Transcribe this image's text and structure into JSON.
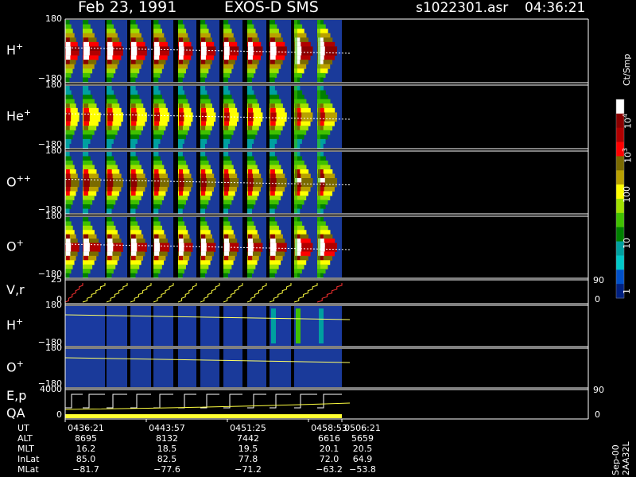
{
  "header": {
    "date": "Feb 23, 1991",
    "instrument": "EXOS-D SMS",
    "file": "s1022301.asr",
    "time": "04:36:21"
  },
  "side_note": "Sep-00 2AA32L",
  "colorbar": {
    "unit": "Ct/Smp",
    "ticks": [
      "10",
      "1",
      "100",
      "10",
      "1"
    ],
    "tick_exps": [
      "4",
      "",
      "",
      "",
      ""
    ],
    "tick_lbl_0": "10",
    "tick_lbl_0_exp": "4",
    "tick_lbl_1": "10",
    "tick_lbl_1_exp": "3",
    "tick_lbl_2": "100",
    "tick_lbl_3": "10",
    "tick_lbl_4": "1",
    "colors": [
      "#ffffff",
      "#8b0000",
      "#b00000",
      "#ff0000",
      "#7a6a00",
      "#b8a000",
      "#ffff00",
      "#a0e000",
      "#40c000",
      "#008000",
      "#00a0a0",
      "#00c8c8",
      "#0050c8",
      "#002080"
    ]
  },
  "panels": [
    {
      "label": "H",
      "sup": "+",
      "ymax": "180",
      "ymin": "−180"
    },
    {
      "label": "He",
      "sup": "+",
      "ymax": "180",
      "ymin": "−180"
    },
    {
      "label": "O",
      "sup": "++",
      "ymax": "180",
      "ymin": "−180"
    },
    {
      "label": "O",
      "sup": "+",
      "ymax": "180",
      "ymin": "−180"
    },
    {
      "label": "V,r",
      "sup": "",
      "ymax": "25",
      "ymin": "0",
      "rmax": "90",
      "rmin": "0"
    },
    {
      "label": "H",
      "sup": "+",
      "ymax": "180",
      "ymin": "−180"
    },
    {
      "label": "O",
      "sup": "+",
      "ymax": "180",
      "ymin": "−180"
    },
    {
      "label": "E,p",
      "sup": "",
      "ymax": "4000",
      "ymin": "0",
      "rmax": "90",
      "rmin": "0"
    }
  ],
  "qa_label": "QA",
  "footer": {
    "rows": [
      {
        "name": "UT",
        "values": [
          "0436:21",
          "0443:57",
          "0451:25",
          "0458:53",
          "0506:21"
        ]
      },
      {
        "name": "ALT",
        "values": [
          "8695",
          "8132",
          "7442",
          "6616",
          "5659"
        ]
      },
      {
        "name": "MLT",
        "values": [
          "16.2",
          "18.5",
          "19.5",
          "20.1",
          "20.5"
        ]
      },
      {
        "name": "InLat",
        "values": [
          "85.0",
          "82.5",
          "77.8",
          "72.0",
          "64.9"
        ]
      },
      {
        "name": "MLat",
        "values": [
          "−81.7",
          "−77.6",
          "−71.2",
          "−63.2",
          "−53.8"
        ]
      }
    ]
  },
  "chart_data": {
    "type": "heatmap",
    "title": "Feb 23, 1991 EXOS-D SMS",
    "x_tick_labels": [
      "0436:21",
      "0443:57",
      "0451:25",
      "0458:53",
      "0506:21"
    ],
    "series": [
      {
        "name": "H+",
        "ylim": [
          -180,
          180
        ]
      },
      {
        "name": "He+",
        "ylim": [
          -180,
          180
        ]
      },
      {
        "name": "O++",
        "ylim": [
          -180,
          180
        ]
      },
      {
        "name": "O+",
        "ylim": [
          -180,
          180
        ]
      },
      {
        "name": "V,r",
        "ylim": [
          0,
          25
        ]
      },
      {
        "name": "H+",
        "ylim": [
          -180,
          180
        ]
      },
      {
        "name": "O+",
        "ylim": [
          -180,
          180
        ]
      },
      {
        "name": "E,p",
        "ylim": [
          0,
          4000
        ]
      }
    ],
    "colorbar_label": "Ct/Smp",
    "colorbar_ticks": [
      "10^4",
      "10^3",
      "100",
      "10",
      "1"
    ],
    "spin_count": 12
  }
}
